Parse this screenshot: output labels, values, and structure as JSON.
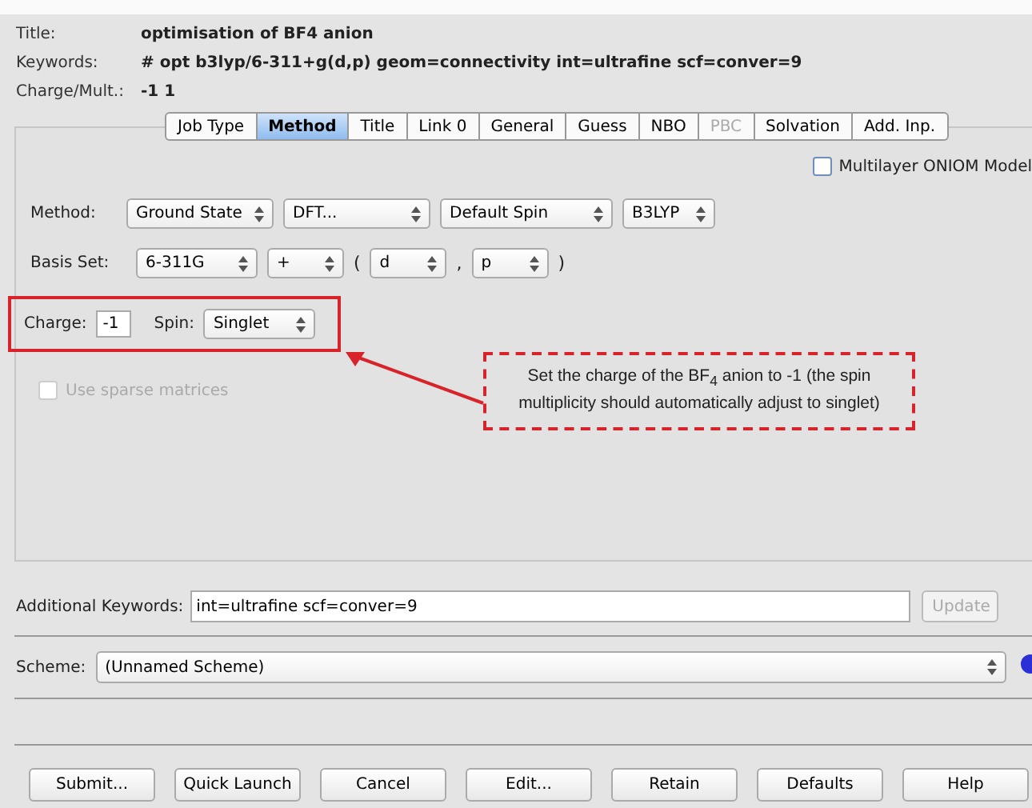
{
  "header": [
    {
      "label": "Title:",
      "value": "optimisation of BF4 anion"
    },
    {
      "label": "Keywords:",
      "value": "# opt b3lyp/6-311+g(d,p) geom=connectivity int=ultrafine scf=conver=9"
    },
    {
      "label": "Charge/Mult.:",
      "value": "-1 1"
    }
  ],
  "tabs": [
    {
      "label": "Job Type",
      "selected": false,
      "disabled": false
    },
    {
      "label": "Method",
      "selected": true,
      "disabled": false
    },
    {
      "label": "Title",
      "selected": false,
      "disabled": false
    },
    {
      "label": "Link 0",
      "selected": false,
      "disabled": false
    },
    {
      "label": "General",
      "selected": false,
      "disabled": false
    },
    {
      "label": "Guess",
      "selected": false,
      "disabled": false
    },
    {
      "label": "NBO",
      "selected": false,
      "disabled": false
    },
    {
      "label": "PBC",
      "selected": false,
      "disabled": true
    },
    {
      "label": "Solvation",
      "selected": false,
      "disabled": false
    },
    {
      "label": "Add. Inp.",
      "selected": false,
      "disabled": false
    }
  ],
  "oniom": {
    "label": "Multilayer ONIOM Model",
    "checked": false
  },
  "method": {
    "label": "Method:",
    "selects": [
      "Ground State",
      "DFT...",
      "Default Spin",
      "B3LYP"
    ]
  },
  "basis": {
    "label": "Basis Set:",
    "parts": [
      {
        "kind": "select",
        "text": "6-311G"
      },
      {
        "kind": "select",
        "text": "+"
      },
      {
        "kind": "sep",
        "text": "("
      },
      {
        "kind": "select",
        "text": "d"
      },
      {
        "kind": "sep",
        "text": ","
      },
      {
        "kind": "select",
        "text": "p"
      },
      {
        "kind": "sep",
        "text": ")"
      }
    ]
  },
  "charge": {
    "label": "Charge:",
    "value": "-1",
    "spin_label": "Spin:",
    "spin": "Singlet"
  },
  "sparse": {
    "label": "Use sparse matrices",
    "checked": false,
    "disabled": true
  },
  "callout": {
    "text": "Set the charge of the BF$_{4}$ anion to -1 (the spin multiplicity should automatically adjust to singlet)"
  },
  "additional": {
    "label": "Additional Keywords:",
    "value": "int=ultrafine scf=conver=9",
    "button": "Update",
    "button_disabled": true
  },
  "scheme": {
    "label": "Scheme:",
    "value": "(Unnamed Scheme)"
  },
  "buttons": [
    "Submit...",
    "Quick Launch",
    "Cancel",
    "Edit...",
    "Retain",
    "Defaults",
    "Help"
  ]
}
